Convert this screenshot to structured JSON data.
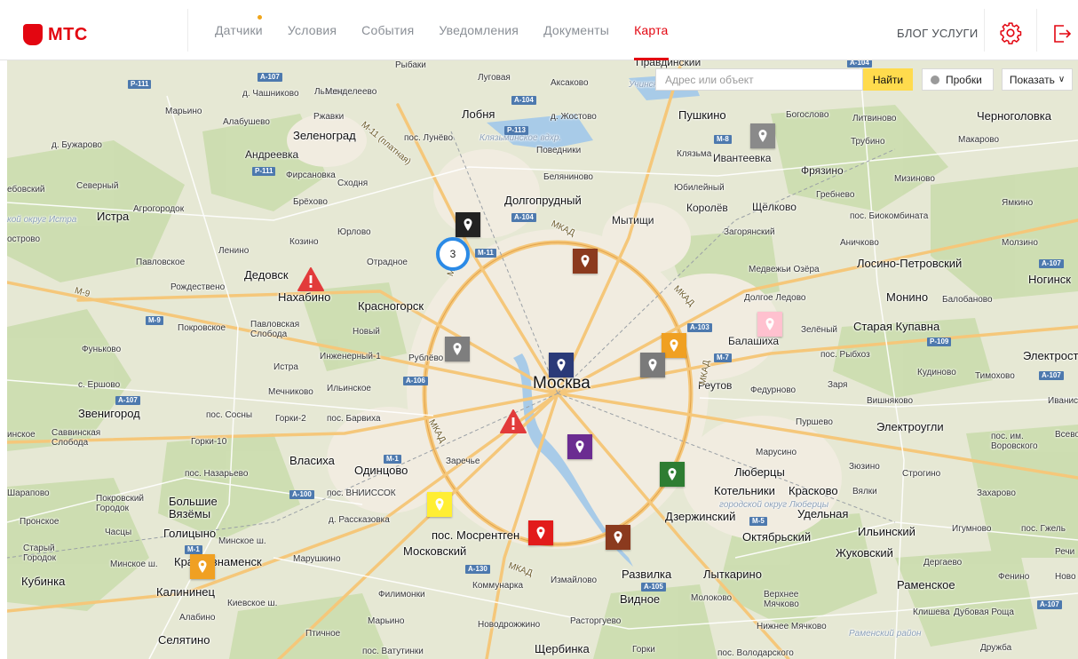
{
  "brand": {
    "name": "МТС",
    "color": "#e30611"
  },
  "nav": {
    "items": [
      {
        "label": "Датчики",
        "active": false,
        "dot": true
      },
      {
        "label": "Условия",
        "active": false,
        "dot": false
      },
      {
        "label": "События",
        "active": false,
        "dot": false
      },
      {
        "label": "Уведомления",
        "active": false,
        "dot": false
      },
      {
        "label": "Документы",
        "active": false,
        "dot": false
      },
      {
        "label": "Карта",
        "active": true,
        "dot": false
      }
    ],
    "blog_label": "БЛОГ УСЛУГИ"
  },
  "icons": {
    "settings": "gear-icon",
    "logout": "logout-icon",
    "marker": "map-pin-icon",
    "alert": "warning-triangle-icon"
  },
  "map_controls": {
    "search_placeholder": "Адрес или объект",
    "find_label": "Найти",
    "traffic_label": "Пробки",
    "show_label": "Показать"
  },
  "cluster": {
    "count": "3"
  },
  "markers": [
    {
      "id": "m1",
      "color": "#222222"
    },
    {
      "id": "m2",
      "color": "#8b3a1e"
    },
    {
      "id": "m3",
      "color": "#8a8a8a"
    },
    {
      "id": "m4",
      "color": "#ffc1cf"
    },
    {
      "id": "m5",
      "color": "#f0a022"
    },
    {
      "id": "m6",
      "color": "#7a7a7a"
    },
    {
      "id": "m7",
      "color": "#7e7e7e"
    },
    {
      "id": "m8",
      "color": "#2a3a78"
    },
    {
      "id": "m9",
      "color": "#6b2c91"
    },
    {
      "id": "m10",
      "color": "#2e7d32"
    },
    {
      "id": "m11",
      "color": "#ffee33"
    },
    {
      "id": "m12",
      "color": "#e21b1b"
    },
    {
      "id": "m13",
      "color": "#8b3a1e"
    },
    {
      "id": "m14",
      "color": "#f0a022"
    }
  ],
  "alerts": [
    {
      "id": "a1",
      "color": "#e23b3b"
    },
    {
      "id": "a2",
      "color": "#e23b3b"
    }
  ],
  "map_labels": {
    "moscow": "Москва",
    "lvs": "Львово",
    "rybaki": "Рыбаки",
    "lugovaya": "Луговая",
    "aksakovo": "Аксаково",
    "pravdinsky": "Правдинский",
    "chashnikovo": "д. Чашниково",
    "mendeleevo": "Менделеево",
    "uchinskoe": "Учинское вдхр.",
    "maryino1": "Марьино",
    "alabushevo": "Алабушево",
    "rzhavki": "Ржавки",
    "lobnya": "Лобня",
    "zhostovo": "д. Жостово",
    "pushkino": "Пушкино",
    "bogoslovo": "Богослово",
    "litvinovo": "Литвиново",
    "chernogolovka": "Черноголовка",
    "zelenograd": "Зеленоград",
    "pos_lunevo": "пос. Лунёво",
    "klyazminskoe": "Клязьминское вдхр.",
    "truzhenik": "Трубино",
    "makarovo": "Макарово",
    "buzharovo": "д. Бужарово",
    "andreevka": "Андреевка",
    "povedniki": "Поведники",
    "klyazma": "Клязьма",
    "ivanteevka": "Ивантеевка",
    "firsanovka": "Фирсановка",
    "skhodnya": "Сходня",
    "belyaninovo": "Беляниново",
    "fryazino": "Фрязино",
    "severny": "Северный",
    "mizinovo": "Мизиново",
    "ebovsky": "ебовский",
    "agrogorodok": "Агрогородок",
    "brekhovo": "Брёхово",
    "dolgoprudny": "Долгопрудный",
    "yubileyny": "Юбилейный",
    "grebnevo": "Гребнево",
    "istra_region": "Истрa",
    "istra": "Истра",
    "korolev": "Королёв",
    "schelkovo": "Щёлково",
    "pos_biokombinata": "пос. Биокомбината",
    "yamkino": "Ямкино",
    "mytischi": "Мытищи",
    "yurlovo": "Юрлово",
    "zagoryansky": "Загорянский",
    "ostrovo": "острово",
    "kozino": "Козино",
    "lenino": "Ленино",
    "anichkovo": "Аничково",
    "molzino": "Молзино",
    "pavlovskoe": "Павловское",
    "otradnoe": "Отрадное",
    "medvezhi": "Медвежьи Озёра",
    "losino": "Лосино-Петровский",
    "dedovsk": "Дедовск",
    "rozhdestveno": "Рождествено",
    "nakhabino": "Нахабино",
    "dolgoe_ledovo": "Долгое Ледово",
    "monino": "Монино",
    "balobanovo": "Балобаново",
    "noginsk": "Ногинск",
    "krasnogorsk": "Красногорск",
    "pokrovskoe": "Покровское",
    "pavlovskaya": "Павловская Слобода",
    "novy": "Новый",
    "zeleny": "Зелёный",
    "staraya_kupavna": "Старая Купавна",
    "balashikha": "Балашиха",
    "funkovo": "Фуньково",
    "inzhenerny": "Инженерный-1",
    "rublevo": "Рублёво",
    "pos_rybkhoz": "пос. Рыбхоз",
    "elektrost": "Электрост",
    "istra2": "Истра",
    "kudinovo": "Кудиново",
    "timohovo": "Тимохово",
    "ershovo": "с. Ершово",
    "mechnikovo": "Мечниково",
    "ilinskoe": "Ильинское",
    "reutov": "Реутов",
    "fedurnovo": "Федурново",
    "zarya": "Заря",
    "vishnyakovo": "Вишняково",
    "ivanis": "Иванис",
    "zvenigorod": "Звенигород",
    "pos_sosny": "пос. Сосны",
    "gorki2": "Горки-2",
    "pos_barvikha": "пос. Барвиха",
    "purshevo": "Пуршево",
    "elektrougli": "Электроугли",
    "savvinskaya": "Саввинская Слобода",
    "inskoe": "инское",
    "gorki10": "Горки-10",
    "pos_vorovskogo": "пос. им. Воровского",
    "vsevo": "Всево",
    "vlasikha": "Власиха",
    "odintsovo": "Одинцово",
    "zarechye": "Заречье",
    "marusino": "Марусино",
    "lyubertsy": "Люберцы",
    "zyuzino": "Зюзино",
    "stroginо": "Строгино",
    "pos_nazaryevo": "пос. Назарьево",
    "sharapovo": "Шарапово",
    "pokrovsky_gorodok": "Покровский Городок",
    "bolshie": "Большие Вязёмы",
    "pos_vniissok": "пос. ВНИИССОК",
    "kotelniki": "Котельники",
    "kraskovo": "Красково",
    "vyalki": "Вялки",
    "zakharovo": "Захарово",
    "dzerzhinsky_region": "городской округ Люберцы",
    "dzerzhinsky": "Дзержинский",
    "udelnaya": "Удельная",
    "pronskoe": "Пронское",
    "chasy": "Часцы",
    "golitsyno": "Голицыно",
    "rasskazovka": "д. Рассказовка",
    "pos_mosrentgen": "пос. Мосрентген",
    "oktyabrsky": "Октябрьский",
    "ilinsky": "Ильинский",
    "igumnovo": "Игумново",
    "pos_gzhel": "пос. Гжель",
    "stary_gorodok": "Старый Городок",
    "minskoe_sh": "Минское ш.",
    "minskoe_sh2": "Минское ш.",
    "krasnoznamensk": "Краснознаменск",
    "marushkino": "Марушкино",
    "moskovsky": "Московский",
    "zhukovsky": "Жуковский",
    "rechi": "Речи",
    "kubinka": "Кубинка",
    "degraevo": "Дергаево",
    "kommunarka": "Коммунарка",
    "izmaylovo": "Измайлово",
    "razvilka": "Развилка",
    "lytkarino": "Лыткарино",
    "fenino": "Фенино",
    "novo": "Ново",
    "kalininets": "Калининец",
    "filimonki": "Филимонки",
    "vidnoe": "Видное",
    "molokovo": "Молоково",
    "verkhnee": "Верхнее Мячково",
    "ramenskoe": "Раменское",
    "alabino": "Алабино",
    "kievskoe": "Киевское ш.",
    "maryino2": "Марьино",
    "novodrozhzhino": "Новодрожжино",
    "rastorguevo": "Расторгуево",
    "klishева": "Клишева",
    "dubovaya": "Дубовая Роща",
    "selyatino": "Селятино",
    "ptichnoe": "Птичное",
    "nizhnee": "Нижнее Мячково",
    "ramensky_region": "Раменский район",
    "druzhba": "Дружба",
    "pos_vatutinki": "пос. Ватутинки",
    "shcherbinka": "Щербинка",
    "gorki": "Горки",
    "pos_volodarskogo": "пос. Володарского",
    "mkad1": "МКАД",
    "mkad2": "МКАД",
    "mkad3": "МКАД",
    "mkad4": "МКАД",
    "mkad5": "МКАД",
    "mkad6": "МКАД",
    "m11": "М-11 (платная)",
    "m9": "М-9",
    "mo_istra": "кой округ Истра"
  },
  "road_shields": [
    "P-111",
    "A-107",
    "A-104",
    "P-113",
    "A-104",
    "M-8",
    "P-111",
    "A-104",
    "M-11",
    "A-107",
    "M-9",
    "A-103",
    "P-109",
    "M-7",
    "A-106",
    "A-107",
    "M-1",
    "A-100",
    "M-5",
    "M-1",
    "A-130",
    "A-105",
    "A-107",
    "A-107"
  ]
}
